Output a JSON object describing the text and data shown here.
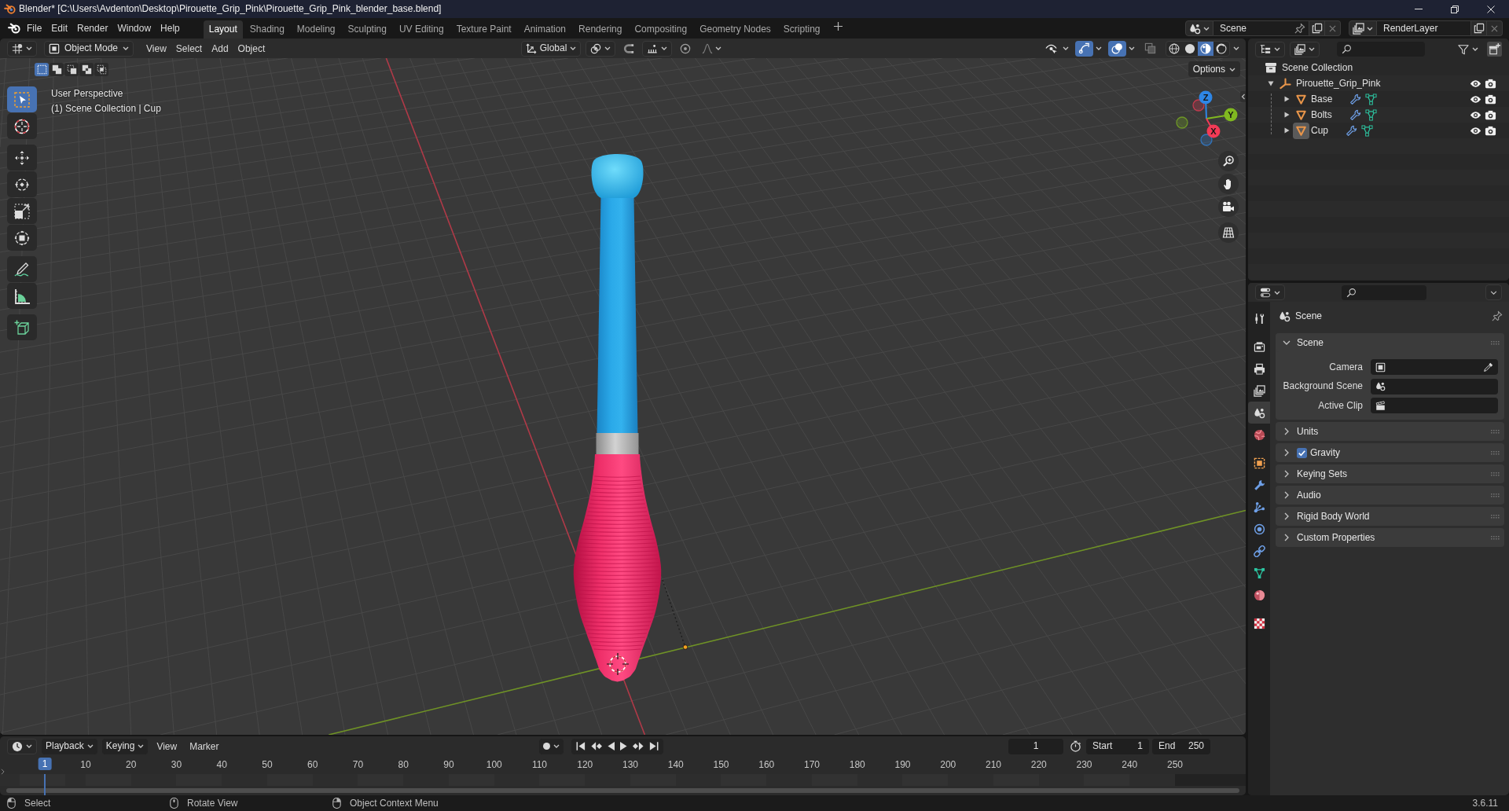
{
  "window": {
    "title": "Blender* [C:\\Users\\Avdenton\\Desktop\\Pirouette_Grip_Pink\\Pirouette_Grip_Pink_blender_base.blend]"
  },
  "top_bar": {
    "menus": [
      "File",
      "Edit",
      "Render",
      "Window",
      "Help"
    ],
    "workspaces": [
      {
        "label": "Layout",
        "selected": true
      },
      {
        "label": "Shading",
        "selected": false
      },
      {
        "label": "Modeling",
        "selected": false
      },
      {
        "label": "Sculpting",
        "selected": false
      },
      {
        "label": "UV Editing",
        "selected": false
      },
      {
        "label": "Texture Paint",
        "selected": false
      },
      {
        "label": "Animation",
        "selected": false
      },
      {
        "label": "Rendering",
        "selected": false
      },
      {
        "label": "Compositing",
        "selected": false
      },
      {
        "label": "Geometry Nodes",
        "selected": false
      },
      {
        "label": "Scripting",
        "selected": false
      }
    ],
    "scene": "Scene",
    "view_layer": "RenderLayer"
  },
  "viewport": {
    "mode": "Object Mode",
    "menus": [
      "View",
      "Select",
      "Add",
      "Object"
    ],
    "orientation": "Global",
    "toggles": [
      {
        "kind": "visibility",
        "on": false
      },
      {
        "kind": "gizmos",
        "on": true
      },
      {
        "kind": "overlays",
        "on": true
      },
      {
        "kind": "xray",
        "on": false
      }
    ],
    "shading_modes": [
      {
        "kind": "wireframe",
        "selected": false
      },
      {
        "kind": "solid",
        "selected": false
      },
      {
        "kind": "material",
        "selected": true
      },
      {
        "kind": "rendered",
        "selected": false
      }
    ],
    "select_modes": [
      {
        "kind": "set",
        "selected": true
      },
      {
        "kind": "extend",
        "selected": false
      },
      {
        "kind": "subtract",
        "selected": false
      },
      {
        "kind": "difference",
        "selected": false
      },
      {
        "kind": "intersect",
        "selected": false
      }
    ],
    "options": "Options",
    "view_name": "User Perspective",
    "context": "(1) Scene Collection | Cup",
    "tool_groups": [
      {
        "tools": [
          {
            "kind": "select_box",
            "selected": true
          },
          {
            "kind": "cursor",
            "selected": false
          }
        ]
      },
      {
        "tools": [
          {
            "kind": "move",
            "selected": false
          },
          {
            "kind": "rotate",
            "selected": false
          },
          {
            "kind": "scale",
            "selected": false
          },
          {
            "kind": "transform",
            "selected": false
          }
        ]
      },
      {
        "tools": [
          {
            "kind": "annotate",
            "selected": false
          },
          {
            "kind": "measure",
            "selected": false
          }
        ]
      },
      {
        "tools": [
          {
            "kind": "add_cube",
            "selected": false
          }
        ]
      }
    ],
    "gizmo_axes": [
      {
        "label": "X",
        "color": "#f33a56"
      },
      {
        "label": "Y",
        "color": "#80b820"
      },
      {
        "label": "Z",
        "color": "#2e86e6"
      }
    ],
    "nav_buttons": [
      {
        "kind": "zoom"
      },
      {
        "kind": "pan"
      },
      {
        "kind": "camera"
      },
      {
        "kind": "ortho"
      }
    ]
  },
  "outliner": {
    "root": "Scene Collection",
    "items": [
      {
        "name": "Pirouette_Grip_Pink",
        "kind": "empty",
        "expanded": true,
        "selected": false,
        "visible": true,
        "renderable": true,
        "children": [
          {
            "name": "Base",
            "kind": "mesh",
            "expanded": false,
            "selected": false,
            "visible": true,
            "renderable": true,
            "badges": [
              {
                "kind": "modifier"
              },
              {
                "kind": "mesh_data"
              }
            ]
          },
          {
            "name": "Bolts",
            "kind": "mesh",
            "expanded": false,
            "selected": false,
            "visible": true,
            "renderable": true,
            "badges": [
              {
                "kind": "modifier"
              },
              {
                "kind": "mesh_data"
              }
            ]
          },
          {
            "name": "Cup",
            "kind": "mesh",
            "expanded": false,
            "selected": true,
            "visible": true,
            "renderable": true,
            "badges": [
              {
                "kind": "modifier"
              },
              {
                "kind": "mesh_data"
              }
            ]
          }
        ]
      }
    ]
  },
  "properties": {
    "tab_groups": [
      {
        "tabs": [
          {
            "kind": "tool",
            "selected": false
          }
        ]
      },
      {
        "tabs": [
          {
            "kind": "render",
            "selected": false
          },
          {
            "kind": "output",
            "selected": false
          },
          {
            "kind": "view_layer",
            "selected": false
          },
          {
            "kind": "scene",
            "selected": true
          },
          {
            "kind": "world",
            "selected": false
          }
        ]
      },
      {
        "tabs": [
          {
            "kind": "object",
            "selected": false
          },
          {
            "kind": "modifiers",
            "selected": false
          },
          {
            "kind": "particles",
            "selected": false
          },
          {
            "kind": "physics",
            "selected": false
          },
          {
            "kind": "constraints",
            "selected": false
          },
          {
            "kind": "data",
            "selected": false
          },
          {
            "kind": "material",
            "selected": false
          }
        ]
      },
      {
        "tabs": [
          {
            "kind": "texture",
            "selected": false
          }
        ]
      }
    ],
    "context": "Scene",
    "panels": [
      {
        "label": "Scene",
        "kind": "plain",
        "expanded": true,
        "fields": [
          {
            "label": "Camera",
            "kind": "object"
          },
          {
            "label": "Background Scene",
            "kind": "scene"
          },
          {
            "label": "Active Clip",
            "kind": "clip"
          }
        ]
      },
      {
        "label": "Units",
        "kind": "plain",
        "expanded": false
      },
      {
        "label": "Gravity",
        "kind": "toggle",
        "checked": true,
        "expanded": false
      },
      {
        "label": "Keying Sets",
        "kind": "plain",
        "expanded": false
      },
      {
        "label": "Audio",
        "kind": "plain",
        "expanded": false
      },
      {
        "label": "Rigid Body World",
        "kind": "plain",
        "expanded": false
      },
      {
        "label": "Custom Properties",
        "kind": "plain",
        "expanded": false
      }
    ]
  },
  "timeline": {
    "menus": [
      {
        "label": "Playback",
        "kind": "dropdown"
      },
      {
        "label": "Keying",
        "kind": "dropdown"
      },
      {
        "label": "View",
        "kind": "menu"
      },
      {
        "label": "Marker",
        "kind": "menu"
      }
    ],
    "current_frame": "1",
    "start_label": "Start",
    "start": "1",
    "end_label": "End",
    "end": "250",
    "playhead": "1",
    "ruler": [
      "10",
      "20",
      "30",
      "40",
      "50",
      "60",
      "70",
      "80",
      "90",
      "100",
      "110",
      "120",
      "130",
      "140",
      "150",
      "160",
      "170",
      "180",
      "190",
      "200",
      "210",
      "220",
      "230",
      "240",
      "250"
    ]
  },
  "status_bar": {
    "hints": [
      {
        "kind": "left",
        "label": "Select"
      },
      {
        "kind": "middle",
        "label": "Rotate View"
      },
      {
        "kind": "right",
        "label": "Object Context Menu"
      }
    ],
    "version": "3.6.11"
  }
}
